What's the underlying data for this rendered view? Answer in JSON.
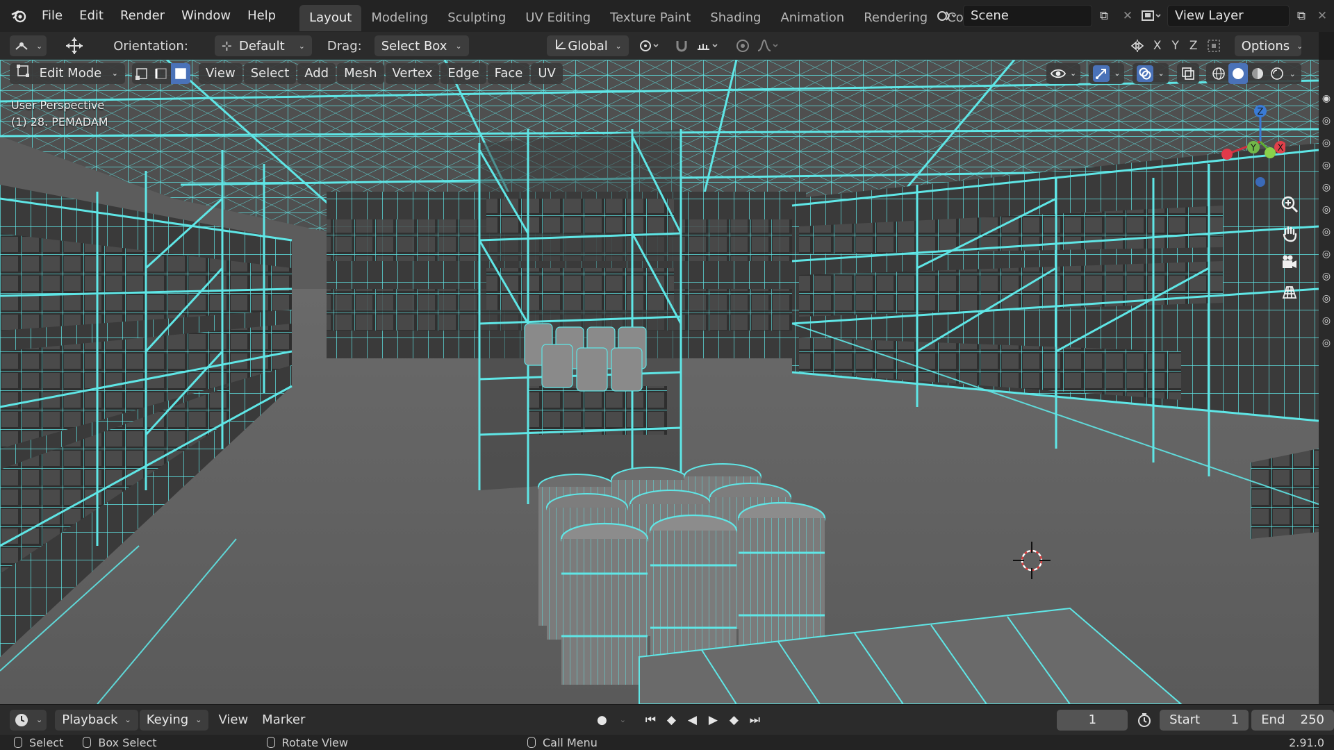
{
  "menu": {
    "file": "File",
    "edit": "Edit",
    "render": "Render",
    "window": "Window",
    "help": "Help"
  },
  "workspaces": [
    "Layout",
    "Modeling",
    "Sculpting",
    "UV Editing",
    "Texture Paint",
    "Shading",
    "Animation",
    "Rendering",
    "Compositin"
  ],
  "scene": {
    "name": "Scene",
    "view_layer": "View Layer"
  },
  "tool_header": {
    "orientation_label": "Orientation:",
    "orientation_value": "Default",
    "drag_label": "Drag:",
    "drag_value": "Select Box",
    "transform_orientation": "Global",
    "axes": [
      "X",
      "Y",
      "Z"
    ],
    "options": "Options"
  },
  "viewport_header": {
    "mode": "Edit Mode",
    "menus": [
      "View",
      "Select",
      "Add",
      "Mesh",
      "Vertex",
      "Edge",
      "Face",
      "UV"
    ]
  },
  "overlay": {
    "perspective": "User Perspective",
    "object": "(1) 28. PEMADAM"
  },
  "gizmo": {
    "z": "Z",
    "y": "Y",
    "x": "X"
  },
  "timeline": {
    "playback": "Playback",
    "keying": "Keying",
    "view": "View",
    "marker": "Marker",
    "current_frame": "1",
    "start_label": "Start",
    "start_value": "1",
    "end_label": "End",
    "end_value": "250"
  },
  "statusbar": {
    "select": "Select",
    "box_select": "Box Select",
    "rotate_view": "Rotate View",
    "call_menu": "Call Menu",
    "version": "2.91.0"
  },
  "colors": {
    "wire": "#5fe6e6",
    "accent": "#4a72b8",
    "floor": "#5f5f5f"
  }
}
